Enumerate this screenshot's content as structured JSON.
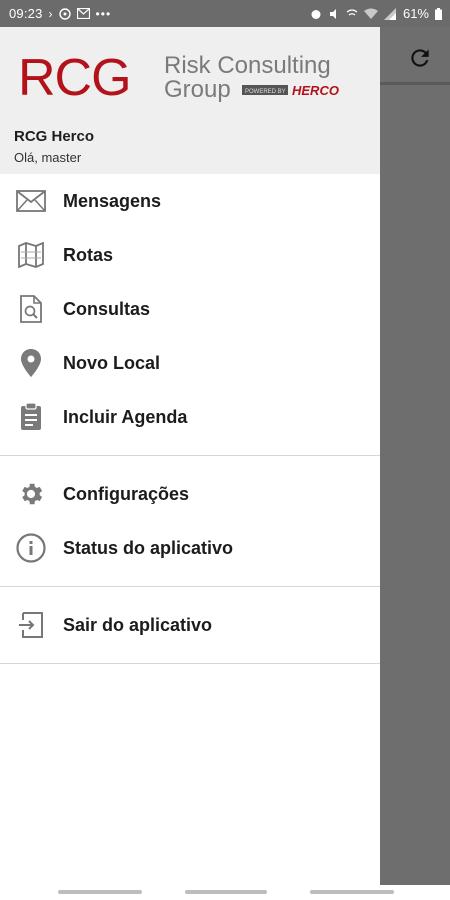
{
  "status_bar": {
    "time": "09:23",
    "battery": "61%"
  },
  "header": {
    "logo_letters": "RCG",
    "logo_line1": "Risk Consulting",
    "logo_line2": "Group",
    "powered_by": "POWERED BY",
    "herco": "HERCO",
    "user_name": "RCG Herco",
    "greeting": "Olá, master"
  },
  "menu": {
    "section1": [
      {
        "label": "Mensagens",
        "icon": "envelope-icon"
      },
      {
        "label": "Rotas",
        "icon": "map-icon"
      },
      {
        "label": "Consultas",
        "icon": "document-search-icon"
      },
      {
        "label": "Novo Local",
        "icon": "location-pin-icon"
      },
      {
        "label": "Incluir Agenda",
        "icon": "clipboard-icon"
      }
    ],
    "section2": [
      {
        "label": "Configurações",
        "icon": "gear-icon"
      },
      {
        "label": "Status do aplicativo",
        "icon": "info-icon"
      }
    ],
    "section3": [
      {
        "label": "Sair do aplicativo",
        "icon": "exit-icon"
      }
    ]
  },
  "colors": {
    "brand_red": "#b3121b",
    "drawer_header_bg": "#efefef",
    "scrim": "#6e6e6e"
  }
}
